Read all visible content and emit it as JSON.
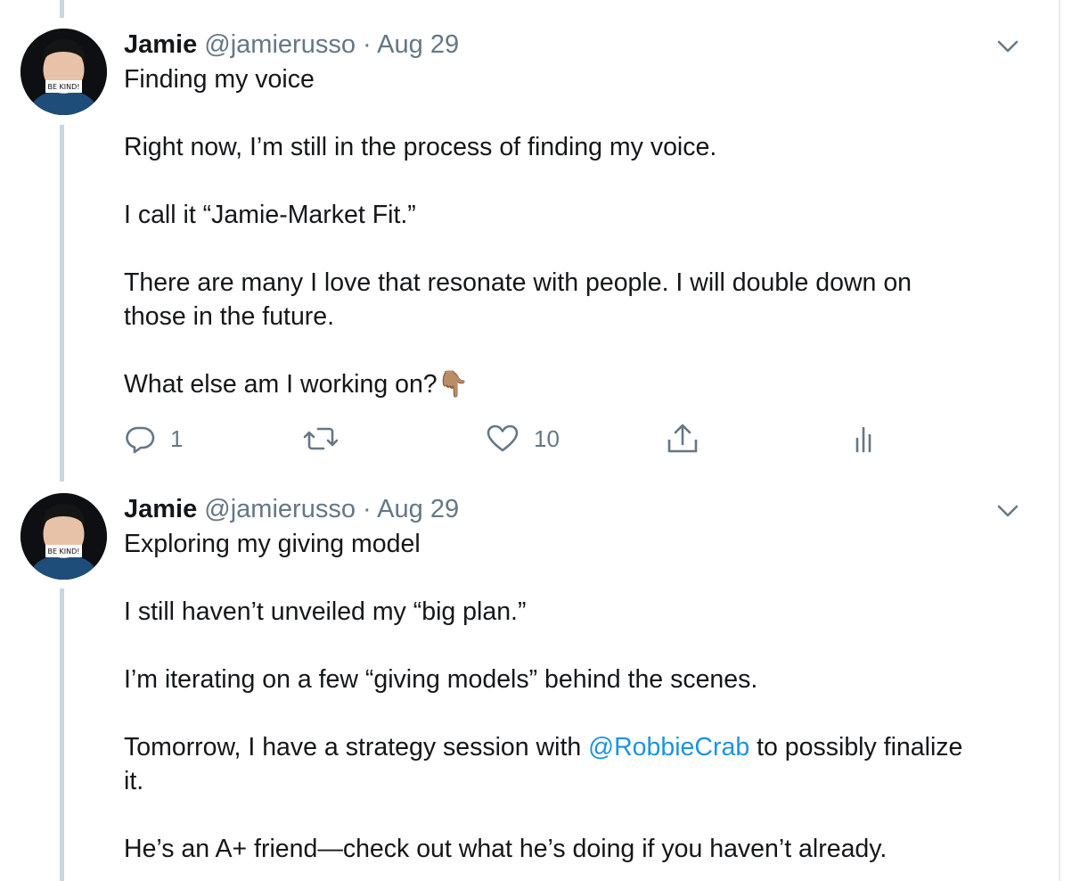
{
  "tweets": [
    {
      "author_name": "Jamie",
      "handle": "@jamierusso",
      "separator": "·",
      "date": "Aug 29",
      "avatar_caption": "BE KIND!",
      "lines": [
        "Finding my voice",
        "",
        "Right now, I’m still in the process of finding my voice.",
        "",
        "I call it “Jamie-Market Fit.”",
        "",
        "There are many I love that resonate with people. I will double down on",
        "those in the future.",
        "",
        "What else am I working on?"
      ],
      "emoji": "👇🏽",
      "actions": {
        "reply_count": "1",
        "retweet_count": "",
        "like_count": "10"
      }
    },
    {
      "author_name": "Jamie",
      "handle": "@jamierusso",
      "separator": "·",
      "date": "Aug 29",
      "avatar_caption": "BE KIND!",
      "lines": [
        "Exploring my giving model",
        "",
        "I still haven’t unveiled my “big plan.”",
        "",
        "I’m iterating on a few “giving models” behind the scenes.",
        ""
      ],
      "mention_line": {
        "before": "Tomorrow, I have a strategy session with ",
        "mention": "@RobbieCrab",
        "after": " to possibly finalize"
      },
      "lines_after": [
        "it.",
        "",
        "He’s an A+ friend—check out what he’s doing if you haven’t already."
      ]
    }
  ],
  "colors": {
    "text": "#14171a",
    "secondary": "#657786",
    "link": "#1b95e0",
    "thread_line": "#ccd6dd"
  },
  "icons": [
    "reply-icon",
    "retweet-icon",
    "like-icon",
    "share-icon",
    "analytics-icon",
    "chevron-down-icon"
  ]
}
